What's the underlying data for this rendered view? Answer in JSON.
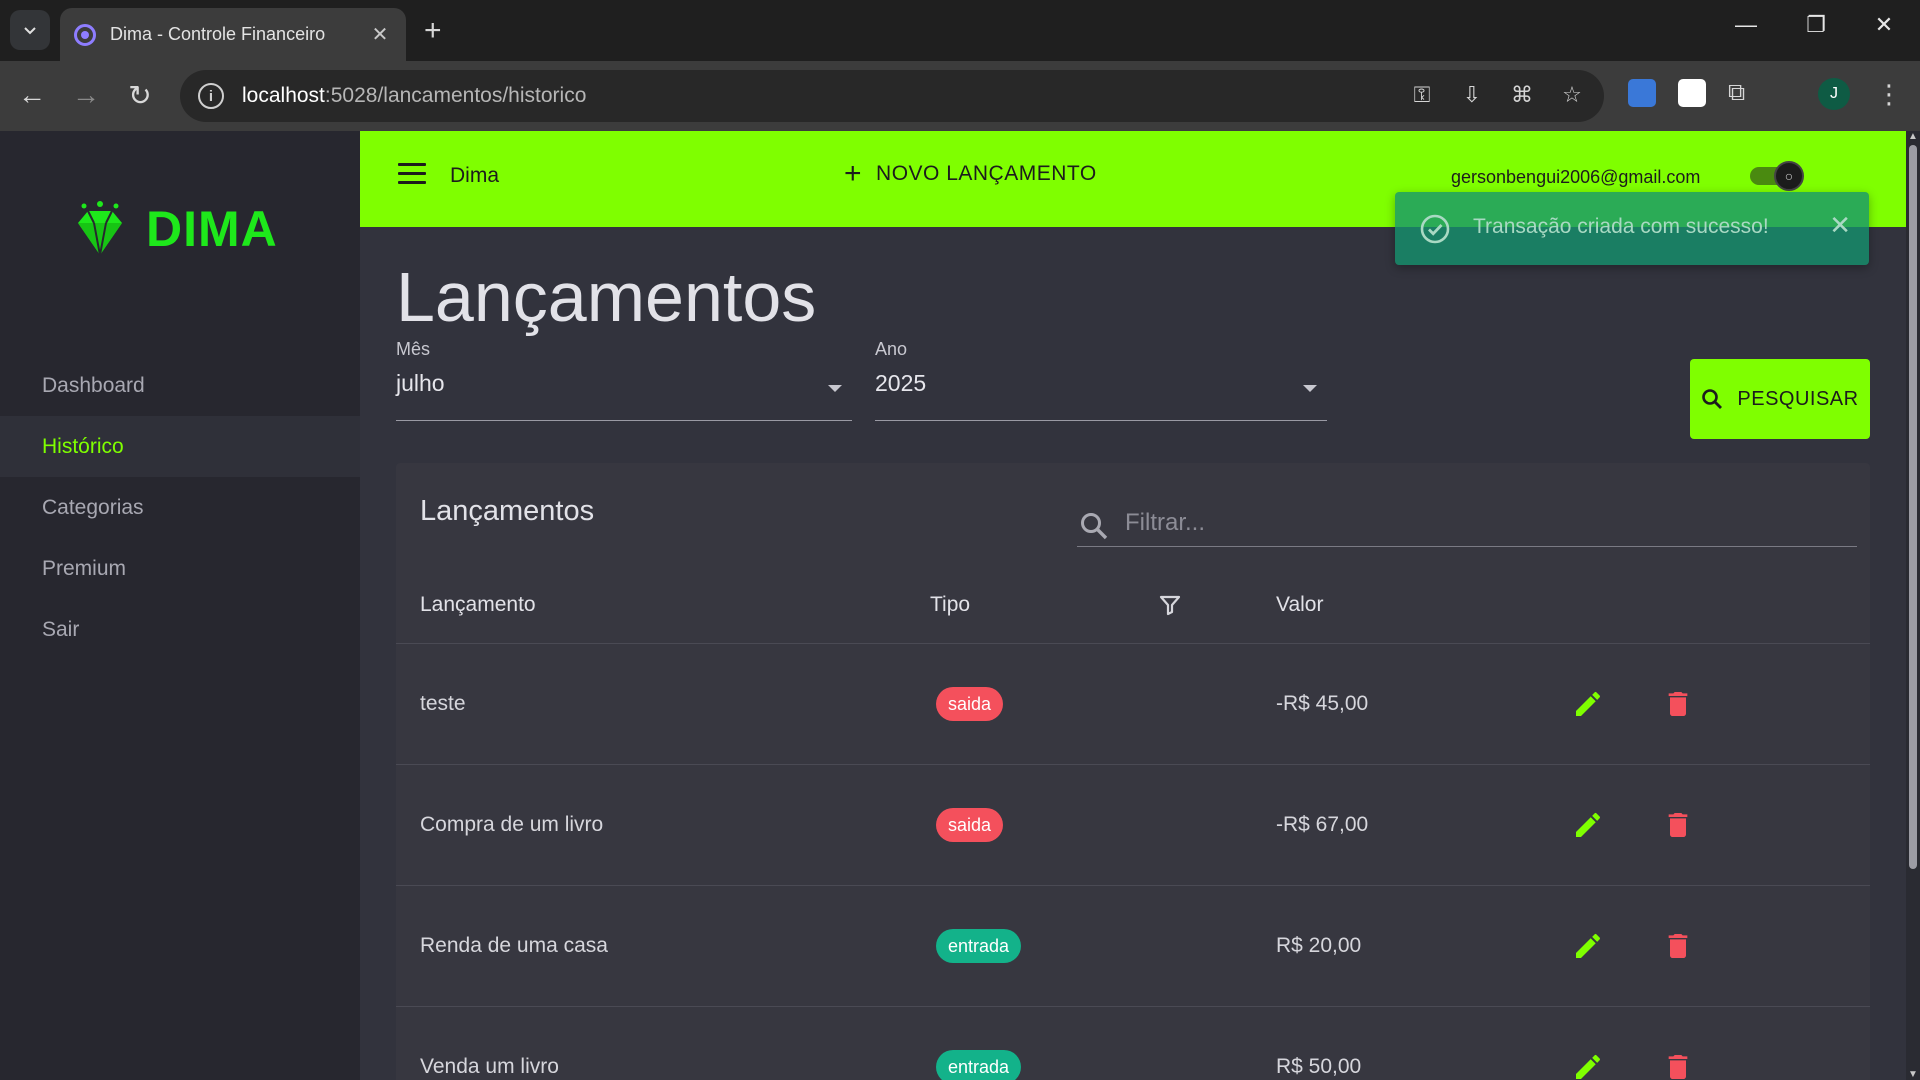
{
  "browser": {
    "tab_title": "Dima - Controle Financeiro",
    "url_host": "localhost",
    "url_path": ":5028/lancamentos/historico",
    "profile_initial": "J"
  },
  "app": {
    "brand": "DIMA",
    "appbar_title": "Dima",
    "new_entry_label": "NOVO LANÇAMENTO",
    "user_email": "gersonbengui2006@gmail.com",
    "accent_color": "#7fff00"
  },
  "sidebar": {
    "items": [
      {
        "label": "Dashboard"
      },
      {
        "label": "Histórico"
      },
      {
        "label": "Categorias"
      },
      {
        "label": "Premium"
      },
      {
        "label": "Sair"
      }
    ]
  },
  "page": {
    "title": "Lançamentos",
    "month_label": "Mês",
    "month_value": "julho",
    "year_label": "Ano",
    "year_value": "2025",
    "search_button": "PESQUISAR"
  },
  "table": {
    "title": "Lançamentos",
    "filter_placeholder": "Filtrar...",
    "headers": {
      "description": "Lançamento",
      "type": "Tipo",
      "value": "Valor"
    },
    "rows": [
      {
        "description": "teste",
        "type": "saida",
        "value": "-R$ 45,00"
      },
      {
        "description": "Compra de um livro",
        "type": "saida",
        "value": "-R$ 67,00"
      },
      {
        "description": "Renda de uma casa",
        "type": "entrada",
        "value": "R$ 20,00"
      },
      {
        "description": "Venda um livro",
        "type": "entrada",
        "value": "R$ 50,00"
      }
    ]
  },
  "toast": {
    "message": "Transação criada com sucesso!"
  }
}
